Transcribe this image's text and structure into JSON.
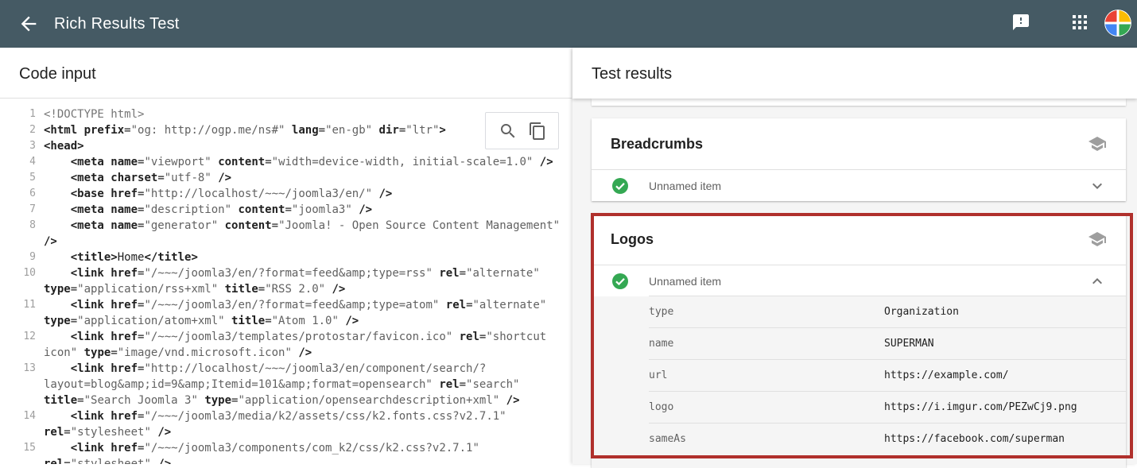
{
  "app": {
    "title": "Rich Results Test",
    "icons": {
      "back": "arrow-left-icon",
      "feedback": "feedback-icon",
      "apps": "apps-grid-icon",
      "avatar": "account-avatar"
    }
  },
  "left_pane": {
    "title": "Code input",
    "toolbar": {
      "search_icon": "search-icon",
      "copy_icon": "copy-icon"
    },
    "code_lines": [
      {
        "num": "1",
        "parts": [
          {
            "t": "<!DOCTYPE html>",
            "c": "cmt"
          }
        ]
      },
      {
        "num": "2",
        "parts": [
          {
            "t": "<html ",
            "c": "tag-b"
          },
          {
            "t": "prefix",
            "c": "tag-b"
          },
          {
            "t": "=",
            "c": ""
          },
          {
            "t": "\"og: http://ogp.me/ns#\"",
            "c": "str"
          },
          {
            "t": " ",
            "c": ""
          },
          {
            "t": "lang",
            "c": "tag-b"
          },
          {
            "t": "=",
            "c": ""
          },
          {
            "t": "\"en-gb\"",
            "c": "str"
          },
          {
            "t": " ",
            "c": ""
          },
          {
            "t": "dir",
            "c": "tag-b"
          },
          {
            "t": "=",
            "c": ""
          },
          {
            "t": "\"ltr\"",
            "c": "str"
          },
          {
            "t": ">",
            "c": "tag-b"
          }
        ]
      },
      {
        "num": "3",
        "parts": [
          {
            "t": "<head>",
            "c": "tag-b"
          }
        ]
      },
      {
        "num": "4",
        "parts": [
          {
            "t": "    <meta ",
            "c": "tag-b"
          },
          {
            "t": "name",
            "c": "tag-b"
          },
          {
            "t": "=",
            "c": ""
          },
          {
            "t": "\"viewport\"",
            "c": "str"
          },
          {
            "t": " ",
            "c": ""
          },
          {
            "t": "content",
            "c": "tag-b"
          },
          {
            "t": "=",
            "c": ""
          },
          {
            "t": "\"width=device-width, initial-scale=1.0\"",
            "c": "str"
          },
          {
            "t": " />",
            "c": "tag-b"
          }
        ]
      },
      {
        "num": "5",
        "parts": [
          {
            "t": "    <meta ",
            "c": "tag-b"
          },
          {
            "t": "charset",
            "c": "tag-b"
          },
          {
            "t": "=",
            "c": ""
          },
          {
            "t": "\"utf-8\"",
            "c": "str"
          },
          {
            "t": " />",
            "c": "tag-b"
          }
        ]
      },
      {
        "num": "6",
        "parts": [
          {
            "t": "    <base ",
            "c": "tag-b"
          },
          {
            "t": "href",
            "c": "tag-b"
          },
          {
            "t": "=",
            "c": ""
          },
          {
            "t": "\"http://localhost/~~~/joomla3/en/\"",
            "c": "str"
          },
          {
            "t": " />",
            "c": "tag-b"
          }
        ]
      },
      {
        "num": "7",
        "parts": [
          {
            "t": "    <meta ",
            "c": "tag-b"
          },
          {
            "t": "name",
            "c": "tag-b"
          },
          {
            "t": "=",
            "c": ""
          },
          {
            "t": "\"description\"",
            "c": "str"
          },
          {
            "t": " ",
            "c": ""
          },
          {
            "t": "content",
            "c": "tag-b"
          },
          {
            "t": "=",
            "c": ""
          },
          {
            "t": "\"joomla3\"",
            "c": "str"
          },
          {
            "t": " />",
            "c": "tag-b"
          }
        ]
      },
      {
        "num": "8",
        "parts": [
          {
            "t": "    <meta ",
            "c": "tag-b"
          },
          {
            "t": "name",
            "c": "tag-b"
          },
          {
            "t": "=",
            "c": ""
          },
          {
            "t": "\"generator\"",
            "c": "str"
          },
          {
            "t": " ",
            "c": ""
          },
          {
            "t": "content",
            "c": "tag-b"
          },
          {
            "t": "=",
            "c": ""
          },
          {
            "t": "\"Joomla! - Open Source Content Management\"",
            "c": "str"
          }
        ]
      },
      {
        "num": "",
        "parts": [
          {
            "t": "/>",
            "c": "tag-b"
          }
        ]
      },
      {
        "num": "9",
        "parts": [
          {
            "t": "    <title>",
            "c": "tag-b"
          },
          {
            "t": "Home",
            "c": ""
          },
          {
            "t": "</title>",
            "c": "tag-b"
          }
        ]
      },
      {
        "num": "10",
        "parts": [
          {
            "t": "    <link ",
            "c": "tag-b"
          },
          {
            "t": "href",
            "c": "tag-b"
          },
          {
            "t": "=",
            "c": ""
          },
          {
            "t": "\"/~~~/joomla3/en/?format=feed&amp;type=rss\"",
            "c": "str"
          },
          {
            "t": " ",
            "c": ""
          },
          {
            "t": "rel",
            "c": "tag-b"
          },
          {
            "t": "=",
            "c": ""
          },
          {
            "t": "\"alternate\"",
            "c": "str"
          }
        ]
      },
      {
        "num": "",
        "parts": [
          {
            "t": "type",
            "c": "tag-b"
          },
          {
            "t": "=",
            "c": ""
          },
          {
            "t": "\"application/rss+xml\"",
            "c": "str"
          },
          {
            "t": " ",
            "c": ""
          },
          {
            "t": "title",
            "c": "tag-b"
          },
          {
            "t": "=",
            "c": ""
          },
          {
            "t": "\"RSS 2.0\"",
            "c": "str"
          },
          {
            "t": " />",
            "c": "tag-b"
          }
        ]
      },
      {
        "num": "11",
        "parts": [
          {
            "t": "    <link ",
            "c": "tag-b"
          },
          {
            "t": "href",
            "c": "tag-b"
          },
          {
            "t": "=",
            "c": ""
          },
          {
            "t": "\"/~~~/joomla3/en/?format=feed&amp;type=atom\"",
            "c": "str"
          },
          {
            "t": " ",
            "c": ""
          },
          {
            "t": "rel",
            "c": "tag-b"
          },
          {
            "t": "=",
            "c": ""
          },
          {
            "t": "\"alternate\"",
            "c": "str"
          }
        ]
      },
      {
        "num": "",
        "parts": [
          {
            "t": "type",
            "c": "tag-b"
          },
          {
            "t": "=",
            "c": ""
          },
          {
            "t": "\"application/atom+xml\"",
            "c": "str"
          },
          {
            "t": " ",
            "c": ""
          },
          {
            "t": "title",
            "c": "tag-b"
          },
          {
            "t": "=",
            "c": ""
          },
          {
            "t": "\"Atom 1.0\"",
            "c": "str"
          },
          {
            "t": " />",
            "c": "tag-b"
          }
        ]
      },
      {
        "num": "12",
        "parts": [
          {
            "t": "    <link ",
            "c": "tag-b"
          },
          {
            "t": "href",
            "c": "tag-b"
          },
          {
            "t": "=",
            "c": ""
          },
          {
            "t": "\"/~~~/joomla3/templates/protostar/favicon.ico\"",
            "c": "str"
          },
          {
            "t": " ",
            "c": ""
          },
          {
            "t": "rel",
            "c": "tag-b"
          },
          {
            "t": "=",
            "c": ""
          },
          {
            "t": "\"shortcut",
            "c": "str"
          }
        ]
      },
      {
        "num": "",
        "parts": [
          {
            "t": "icon\"",
            "c": "str"
          },
          {
            "t": " ",
            "c": ""
          },
          {
            "t": "type",
            "c": "tag-b"
          },
          {
            "t": "=",
            "c": ""
          },
          {
            "t": "\"image/vnd.microsoft.icon\"",
            "c": "str"
          },
          {
            "t": " />",
            "c": "tag-b"
          }
        ]
      },
      {
        "num": "13",
        "parts": [
          {
            "t": "    <link ",
            "c": "tag-b"
          },
          {
            "t": "href",
            "c": "tag-b"
          },
          {
            "t": "=",
            "c": ""
          },
          {
            "t": "\"http://localhost/~~~/joomla3/en/component/search/?",
            "c": "str"
          }
        ]
      },
      {
        "num": "",
        "parts": [
          {
            "t": "layout=blog&amp;id=9&amp;Itemid=101&amp;format=opensearch\"",
            "c": "str"
          },
          {
            "t": " ",
            "c": ""
          },
          {
            "t": "rel",
            "c": "tag-b"
          },
          {
            "t": "=",
            "c": ""
          },
          {
            "t": "\"search\"",
            "c": "str"
          }
        ]
      },
      {
        "num": "",
        "parts": [
          {
            "t": "title",
            "c": "tag-b"
          },
          {
            "t": "=",
            "c": ""
          },
          {
            "t": "\"Search Joomla 3\"",
            "c": "str"
          },
          {
            "t": " ",
            "c": ""
          },
          {
            "t": "type",
            "c": "tag-b"
          },
          {
            "t": "=",
            "c": ""
          },
          {
            "t": "\"application/opensearchdescription+xml\"",
            "c": "str"
          },
          {
            "t": " />",
            "c": "tag-b"
          }
        ]
      },
      {
        "num": "14",
        "parts": [
          {
            "t": "    <link ",
            "c": "tag-b"
          },
          {
            "t": "href",
            "c": "tag-b"
          },
          {
            "t": "=",
            "c": ""
          },
          {
            "t": "\"/~~~/joomla3/media/k2/assets/css/k2.fonts.css?v2.7.1\"",
            "c": "str"
          }
        ]
      },
      {
        "num": "",
        "parts": [
          {
            "t": "rel",
            "c": "tag-b"
          },
          {
            "t": "=",
            "c": ""
          },
          {
            "t": "\"stylesheet\"",
            "c": "str"
          },
          {
            "t": " />",
            "c": "tag-b"
          }
        ]
      },
      {
        "num": "15",
        "parts": [
          {
            "t": "    <link ",
            "c": "tag-b"
          },
          {
            "t": "href",
            "c": "tag-b"
          },
          {
            "t": "=",
            "c": ""
          },
          {
            "t": "\"/~~~/joomla3/components/com_k2/css/k2.css?v2.7.1\"",
            "c": "str"
          }
        ]
      },
      {
        "num": "",
        "parts": [
          {
            "t": "rel",
            "c": "tag-b"
          },
          {
            "t": "=",
            "c": ""
          },
          {
            "t": "\"stylesheet\"",
            "c": "str"
          },
          {
            "t": " />",
            "c": "tag-b"
          }
        ]
      }
    ]
  },
  "right_pane": {
    "title": "Test results",
    "breadcrumbs_card": {
      "title": "Breadcrumbs",
      "item_label": "Unnamed item",
      "icons": {
        "cap": "school-cap-icon",
        "status": "check-circle-icon",
        "toggle": "chevron-down-icon"
      }
    },
    "logos_card": {
      "title": "Logos",
      "item_label": "Unnamed item",
      "icons": {
        "cap": "school-cap-icon",
        "status": "check-circle-icon",
        "toggle": "chevron-up-icon"
      },
      "properties": [
        {
          "key": "type",
          "value": "Organization"
        },
        {
          "key": "name",
          "value": "SUPERMAN"
        },
        {
          "key": "url",
          "value": "https://example.com/"
        },
        {
          "key": "logo",
          "value": "https://i.imgur.com/PEZwCj9.png"
        },
        {
          "key": "sameAs",
          "value": "https://facebook.com/superman"
        }
      ]
    }
  },
  "colors": {
    "app_bar": "#455a64",
    "success_green": "#34a853",
    "highlight_red": "#b0302c"
  }
}
